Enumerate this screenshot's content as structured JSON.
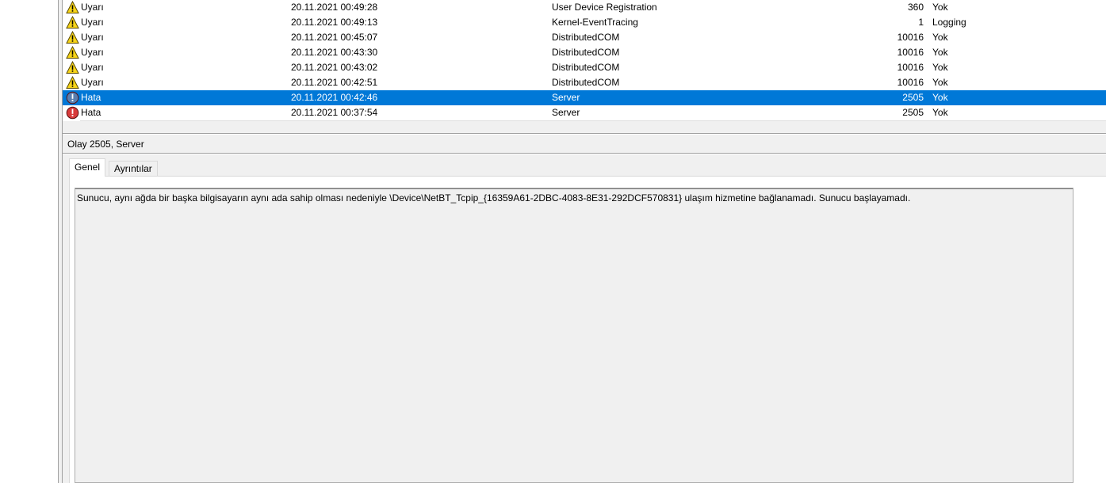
{
  "events": [
    {
      "level": "Uyarı",
      "icon": "warning-icon",
      "date": "20.11.2021 00:49:28",
      "source": "User Device Registration",
      "event_id": "360",
      "task": "Yok",
      "selected": false
    },
    {
      "level": "Uyarı",
      "icon": "warning-icon",
      "date": "20.11.2021 00:49:13",
      "source": "Kernel-EventTracing",
      "event_id": "1",
      "task": "Logging",
      "selected": false
    },
    {
      "level": "Uyarı",
      "icon": "warning-icon",
      "date": "20.11.2021 00:45:07",
      "source": "DistributedCOM",
      "event_id": "10016",
      "task": "Yok",
      "selected": false
    },
    {
      "level": "Uyarı",
      "icon": "warning-icon",
      "date": "20.11.2021 00:43:30",
      "source": "DistributedCOM",
      "event_id": "10016",
      "task": "Yok",
      "selected": false
    },
    {
      "level": "Uyarı",
      "icon": "warning-icon",
      "date": "20.11.2021 00:43:02",
      "source": "DistributedCOM",
      "event_id": "10016",
      "task": "Yok",
      "selected": false
    },
    {
      "level": "Uyarı",
      "icon": "warning-icon",
      "date": "20.11.2021 00:42:51",
      "source": "DistributedCOM",
      "event_id": "10016",
      "task": "Yok",
      "selected": false
    },
    {
      "level": "Hata",
      "icon": "error-icon",
      "date": "20.11.2021 00:42:46",
      "source": "Server",
      "event_id": "2505",
      "task": "Yok",
      "selected": true
    },
    {
      "level": "Hata",
      "icon": "error-icon",
      "date": "20.11.2021 00:37:54",
      "source": "Server",
      "event_id": "2505",
      "task": "Yok",
      "selected": false
    }
  ],
  "details": {
    "title": "Olay 2505, Server",
    "tabs": [
      {
        "label": "Genel",
        "active": true
      },
      {
        "label": "Ayrıntılar",
        "active": false
      }
    ],
    "message": "Sunucu, aynı ağda bir başka bilgisayarın aynı ada sahip olması nedeniyle \\Device\\NetBT_Tcpip_{16359A61-2DBC-4083-8E31-292DCF570831} ulaşım hizmetine bağlanamadı.  Sunucu başlayamadı."
  },
  "colors": {
    "selection": "#0078d7",
    "warning_fill": "#f7d418",
    "error_fill": "#d83b3b",
    "error_fill_selected": "#5a7fb0"
  }
}
